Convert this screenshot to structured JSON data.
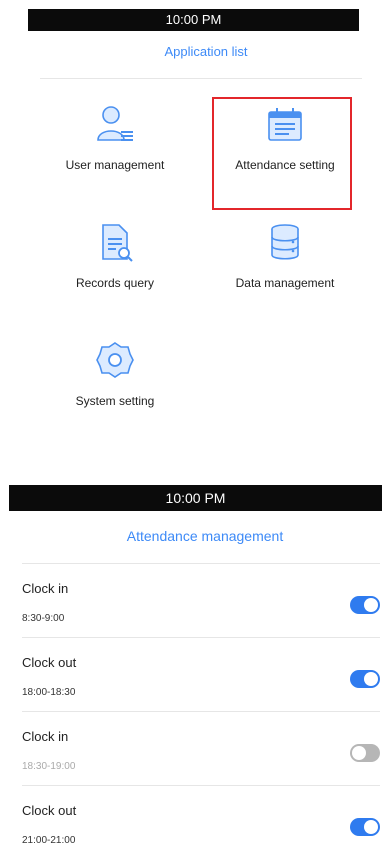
{
  "screen1": {
    "status_time": "10:00 PM",
    "title": "Application list",
    "apps": [
      {
        "label": "User management",
        "icon": "user-icon"
      },
      {
        "label": "Attendance setting",
        "icon": "calendar-icon"
      },
      {
        "label": "Records query",
        "icon": "document-search-icon"
      },
      {
        "label": "Data management",
        "icon": "database-icon"
      },
      {
        "label": "System setting",
        "icon": "gear-icon"
      }
    ]
  },
  "screen2": {
    "status_time": "10:00 PM",
    "title": "Attendance management",
    "rows": [
      {
        "name": "Clock in",
        "time": "8:30-9:00",
        "enabled": true
      },
      {
        "name": "Clock out",
        "time": "18:00-18:30",
        "enabled": true
      },
      {
        "name": "Clock in",
        "time": "18:30-19:00",
        "enabled": false
      },
      {
        "name": "Clock out",
        "time": "21:00-21:00",
        "enabled": true
      }
    ]
  },
  "colors": {
    "accent": "#3d8af7",
    "toggle_on": "#2f7bef",
    "toggle_off": "#b6b6b6",
    "highlight": "#e3262b"
  }
}
